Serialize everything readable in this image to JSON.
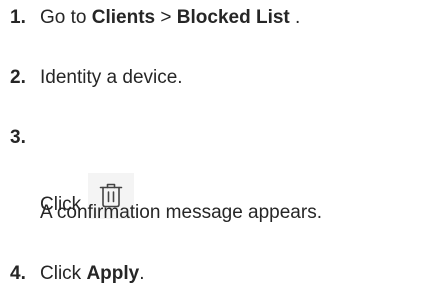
{
  "steps": [
    {
      "number": "1.",
      "prefix": "Go to ",
      "bold1": "Clients",
      "sep": " > ",
      "bold2": "Blocked List",
      "suffix": " ."
    },
    {
      "number": "2.",
      "text": "Identity a device."
    },
    {
      "number": "3.",
      "click_label": "Click ",
      "icon": "trash-icon",
      "after_icon": ".",
      "note": "A confirmation message appears."
    },
    {
      "number": "4.",
      "prefix": "Click ",
      "bold": "Apply",
      "suffix": "."
    }
  ],
  "colors": {
    "text": "#262626",
    "icon_bg": "#f4f4f4",
    "icon_stroke": "#444444"
  }
}
